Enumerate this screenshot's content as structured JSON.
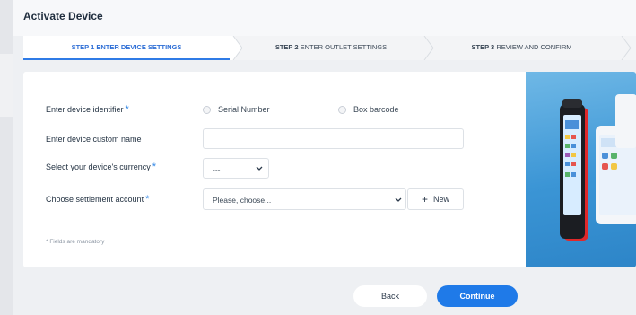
{
  "modal": {
    "title": "Activate Device"
  },
  "steps": [
    {
      "number": "STEP 1",
      "label": "ENTER DEVICE SETTINGS",
      "active": true
    },
    {
      "number": "STEP 2",
      "label": "ENTER OUTLET SETTINGS",
      "active": false
    },
    {
      "number": "STEP 3",
      "label": "REVIEW AND CONFIRM",
      "active": false
    }
  ],
  "form": {
    "identifier": {
      "label": "Enter device identifier",
      "options": [
        "Serial Number",
        "Box barcode"
      ]
    },
    "custom_name": {
      "label": "Enter device custom name",
      "value": ""
    },
    "currency": {
      "label": "Select your device's currency",
      "value": "---"
    },
    "settlement": {
      "label": "Choose settlement account",
      "value": "Please, choose...",
      "new_label": "New",
      "new_symbol": "+"
    },
    "required_marker": "*",
    "mandatory_note": "* Fields are mandatory"
  },
  "footer": {
    "back_label": "Back",
    "continue_label": "Continue"
  },
  "colors": {
    "accent": "#1f7ae8",
    "required": "#2f86e6",
    "image_bg": "#3b95d5",
    "device_red": "#e0282a"
  }
}
